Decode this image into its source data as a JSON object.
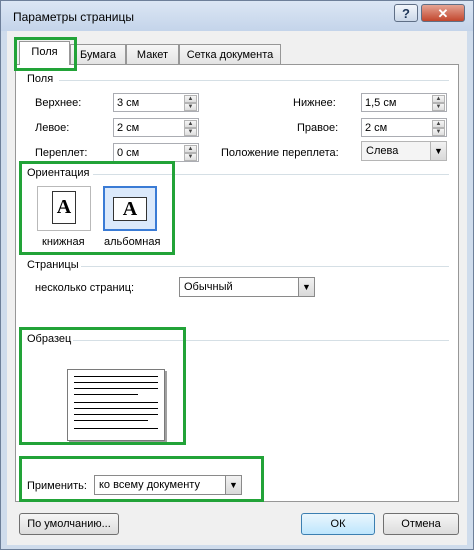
{
  "window": {
    "title": "Параметры страницы",
    "help": "?",
    "close": "✕"
  },
  "tabs": [
    {
      "label": "Поля",
      "active": true
    },
    {
      "label": "Бумага",
      "active": false
    },
    {
      "label": "Макет",
      "active": false
    },
    {
      "label": "Сетка документа",
      "active": false
    }
  ],
  "margins": {
    "section_title": "Поля",
    "top_label": "Верхнее:",
    "top_value": "3 см",
    "bottom_label": "Нижнее:",
    "bottom_value": "1,5 см",
    "left_label": "Левое:",
    "left_value": "2 см",
    "right_label": "Правое:",
    "right_value": "2 см",
    "gutter_label": "Переплет:",
    "gutter_value": "0 см",
    "gutter_pos_label": "Положение переплета:",
    "gutter_pos_value": "Слева"
  },
  "orientation": {
    "section_title": "Ориентация",
    "portrait_label": "книжная",
    "landscape_label": "альбомная",
    "glyph": "A",
    "selected": "landscape"
  },
  "pages": {
    "section_title": "Страницы",
    "multiple_label": "несколько страниц:",
    "multiple_value": "Обычный"
  },
  "preview": {
    "section_title": "Образец"
  },
  "apply": {
    "label": "Применить:",
    "value": "ко всему документу"
  },
  "footer": {
    "default_label": "По умолчанию...",
    "ok_label": "ОК",
    "cancel_label": "Отмена"
  },
  "colors": {
    "highlight": "#22a338",
    "selection": "#3a7bd5"
  }
}
